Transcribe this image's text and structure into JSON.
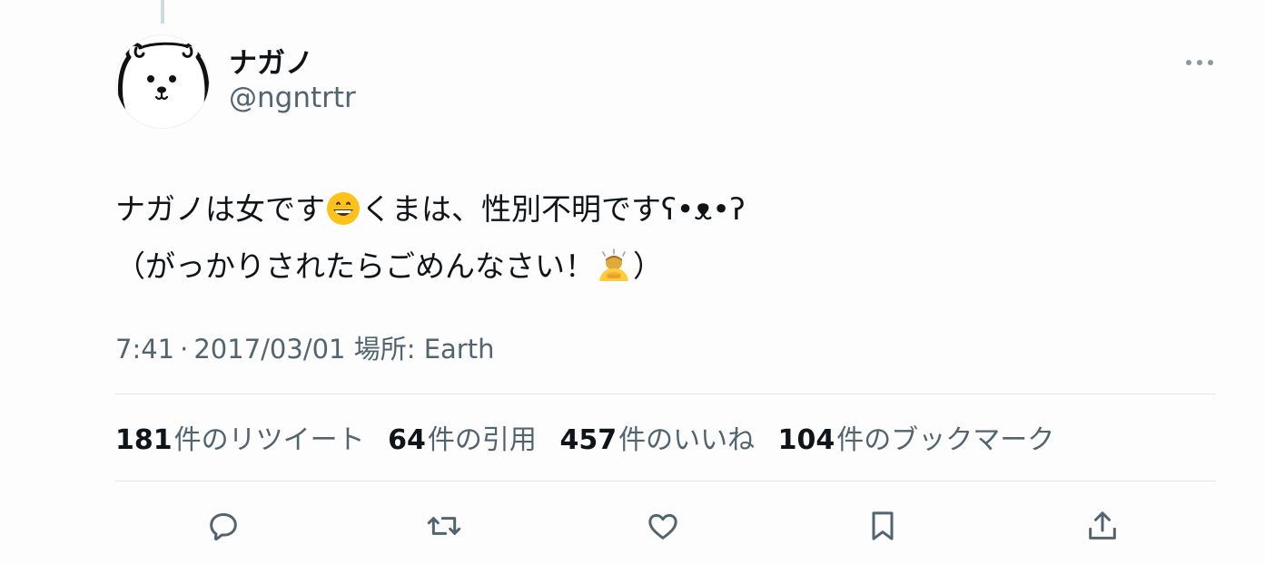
{
  "tweet": {
    "author": {
      "display_name": "ナガノ",
      "handle": "@ngntrtr",
      "avatar_icon": "bear-face-icon"
    },
    "text_line1": {
      "part1": "ナガノは女です",
      "emoji1": "grinning-face-emoji",
      "part2": "くまは、性別不明です",
      "kaomoji": "ʕ•ᴥ•ʔ"
    },
    "text_line2": {
      "part1": "（がっかりされたらごめんなさい！",
      "emoji2": "person-bowing-emoji",
      "part2": "）"
    },
    "meta": {
      "time": "7:41",
      "separator": "·",
      "date": "2017/03/01",
      "location_label": "場所: Earth"
    },
    "stats": [
      {
        "count": "181",
        "label": "件のリツイート"
      },
      {
        "count": "64",
        "label": "件の引用"
      },
      {
        "count": "457",
        "label": "件のいいね"
      },
      {
        "count": "104",
        "label": "件のブックマーク"
      }
    ],
    "actions": [
      "reply-icon",
      "retweet-icon",
      "like-icon",
      "bookmark-icon",
      "share-icon"
    ]
  },
  "colors": {
    "text_primary": "#0f1419",
    "text_secondary": "#536471",
    "divider": "#e1e6ea",
    "background": "#fdfdfd"
  }
}
